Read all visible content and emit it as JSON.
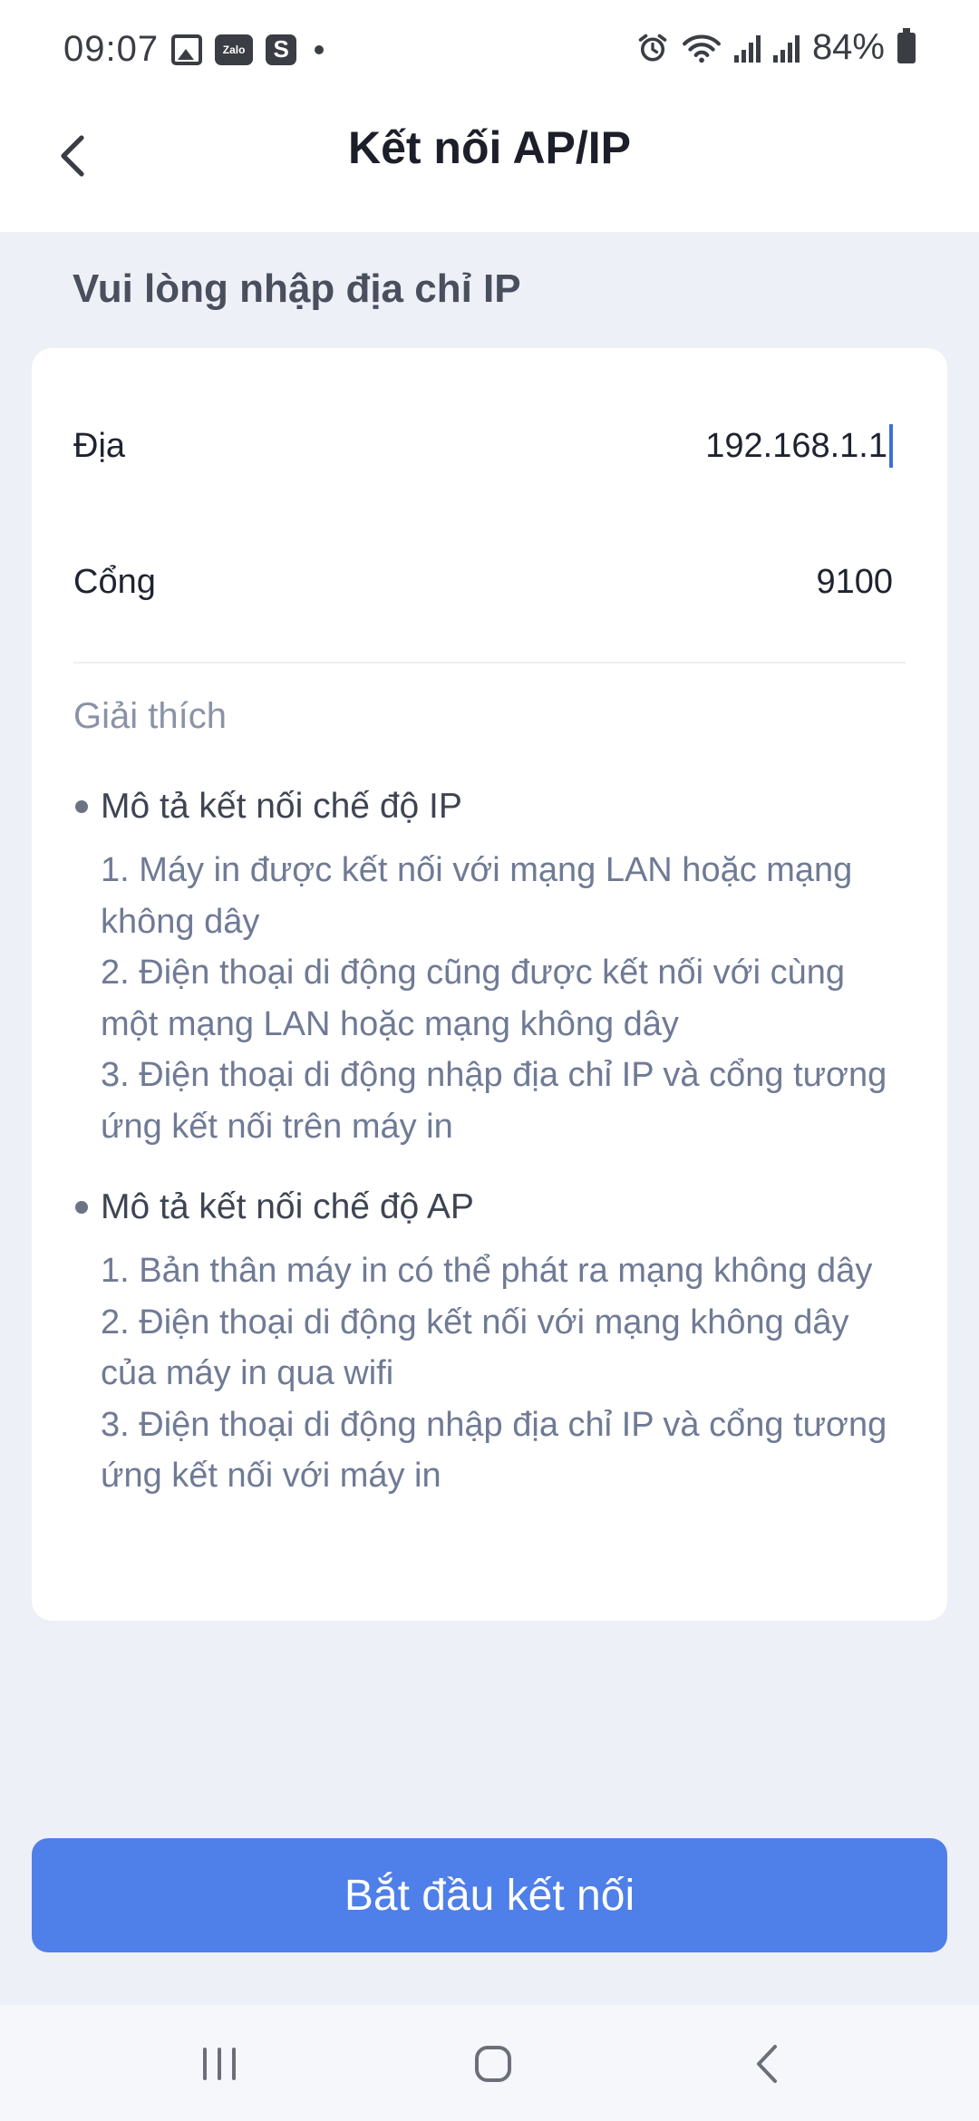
{
  "status_bar": {
    "time": "09:07",
    "zalo_label": "Zalo",
    "s_label": "S",
    "battery": "84%"
  },
  "header": {
    "title": "Kết nối AP/IP"
  },
  "section_title": "Vui lòng nhập địa chỉ IP",
  "form": {
    "address_label": "Địa",
    "address_value": "192.168.1.1",
    "port_label": "Cổng",
    "port_value": "9100"
  },
  "explanation": {
    "title": "Giải thích",
    "modes": [
      {
        "heading": "Mô tả kết nối chế độ IP",
        "steps": [
          "1. Máy in được kết nối với mạng LAN hoặc mạng không dây",
          "2. Điện thoại di động cũng được kết nối với cùng một mạng LAN hoặc mạng không dây",
          "3. Điện thoại di động nhập địa chỉ IP và cổng tương ứng kết nối trên máy in"
        ]
      },
      {
        "heading": "Mô tả kết nối chế độ AP",
        "steps": [
          "1. Bản thân máy in có thể phát ra mạng không dây",
          "2. Điện thoại di động kết nối với mạng không dây của máy in qua wifi",
          "3. Điện thoại di động nhập địa chỉ IP và cổng tương ứng kết nối với máy in"
        ]
      }
    ]
  },
  "start_button_label": "Bắt đầu kết nối",
  "icons": {
    "back": "chevron-left-icon",
    "alarm": "alarm-icon",
    "wifi": "wifi-icon",
    "signal": "signal-icon",
    "battery": "battery-icon"
  },
  "colors": {
    "accent": "#4f7fe8",
    "background": "#eef0f7",
    "muted_text": "#6f7a95"
  }
}
